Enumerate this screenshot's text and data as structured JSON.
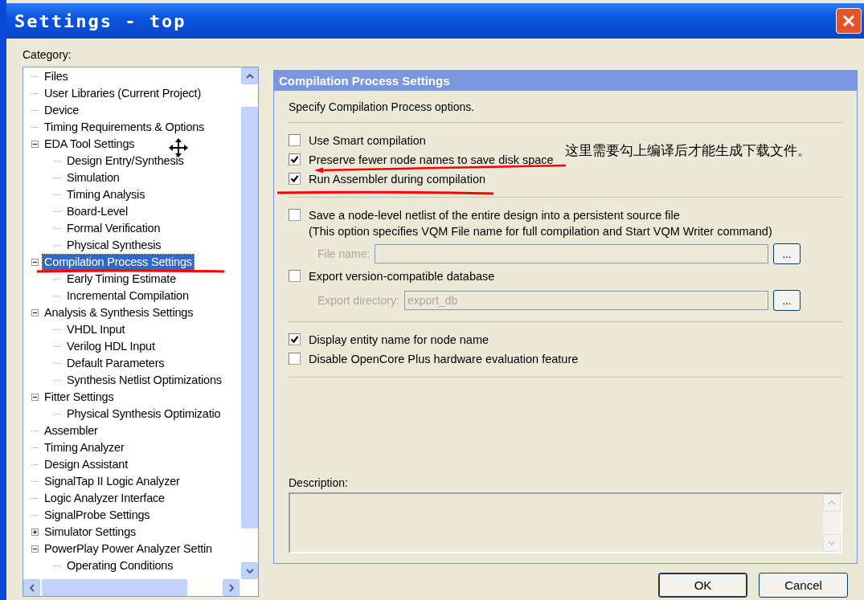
{
  "window": {
    "title": "Settings - top"
  },
  "category_label": "Category:",
  "tree": [
    {
      "label": "Files",
      "selected": false
    },
    {
      "label": "User Libraries (Current Project)",
      "selected": false
    },
    {
      "label": "Device",
      "selected": false
    },
    {
      "label": "Timing Requirements & Options",
      "selected": false
    },
    {
      "label": "EDA Tool Settings",
      "selected": false,
      "expanded": true,
      "children": [
        {
          "label": "Design Entry/Synthesis",
          "selected": false
        },
        {
          "label": "Simulation",
          "selected": false
        },
        {
          "label": "Timing Analysis",
          "selected": false
        },
        {
          "label": "Board-Level",
          "selected": false
        },
        {
          "label": "Formal Verification",
          "selected": false
        },
        {
          "label": "Physical Synthesis",
          "selected": false
        }
      ]
    },
    {
      "label": "Compilation Process Settings",
      "selected": true,
      "expanded": true,
      "children": [
        {
          "label": "Early Timing Estimate",
          "selected": false
        },
        {
          "label": "Incremental Compilation",
          "selected": false
        }
      ]
    },
    {
      "label": "Analysis & Synthesis Settings",
      "selected": false,
      "expanded": true,
      "children": [
        {
          "label": "VHDL Input",
          "selected": false
        },
        {
          "label": "Verilog HDL Input",
          "selected": false
        },
        {
          "label": "Default Parameters",
          "selected": false
        },
        {
          "label": "Synthesis Netlist Optimizations",
          "selected": false
        }
      ]
    },
    {
      "label": "Fitter Settings",
      "selected": false,
      "expanded": true,
      "children": [
        {
          "label": "Physical Synthesis Optimizatio",
          "selected": false
        }
      ]
    },
    {
      "label": "Assembler",
      "selected": false
    },
    {
      "label": "Timing Analyzer",
      "selected": false
    },
    {
      "label": "Design Assistant",
      "selected": false
    },
    {
      "label": "SignalTap II Logic Analyzer",
      "selected": false
    },
    {
      "label": "Logic Analyzer Interface",
      "selected": false
    },
    {
      "label": "SignalProbe Settings",
      "selected": false
    },
    {
      "label": "Simulator Settings",
      "selected": false,
      "expanded": false
    },
    {
      "label": "PowerPlay Power Analyzer Settin",
      "selected": false,
      "expanded": true,
      "children": [
        {
          "label": "Operating Conditions",
          "selected": false
        }
      ]
    }
  ],
  "panel": {
    "title": "Compilation Process Settings",
    "intro": "Specify Compilation Process options.",
    "groups": [
      [
        {
          "kind": "checkbox",
          "label": "Use Smart compilation",
          "checked": false
        },
        {
          "kind": "checkbox",
          "label": "Preserve fewer node names to save disk space",
          "checked": true
        },
        {
          "kind": "checkbox",
          "label": "Run Assembler during compilation",
          "checked": true
        }
      ],
      [
        {
          "kind": "checkbox",
          "label": "Save a node-level netlist of the entire design into a persistent source file",
          "note": "(This option specifies VQM File name for full compilation and Start VQM Writer command)",
          "checked": false
        },
        {
          "kind": "field",
          "label": "File name:",
          "disabled": true,
          "browse": "..."
        },
        {
          "kind": "checkbox",
          "label": "Export version-compatible database",
          "checked": false
        },
        {
          "kind": "field",
          "label": "Export directory:",
          "value": "export_db",
          "disabled": true,
          "browse": "..."
        }
      ],
      [
        {
          "kind": "checkbox",
          "label": "Display entity name for node name",
          "checked": true
        },
        {
          "kind": "checkbox",
          "label": "Disable OpenCore Plus hardware evaluation feature",
          "checked": false
        }
      ]
    ],
    "description_label": "Description:"
  },
  "annotation": {
    "text": "这里需要勾上编译后才能生成下载文件。"
  },
  "buttons": [
    "OK",
    "Cancel"
  ]
}
